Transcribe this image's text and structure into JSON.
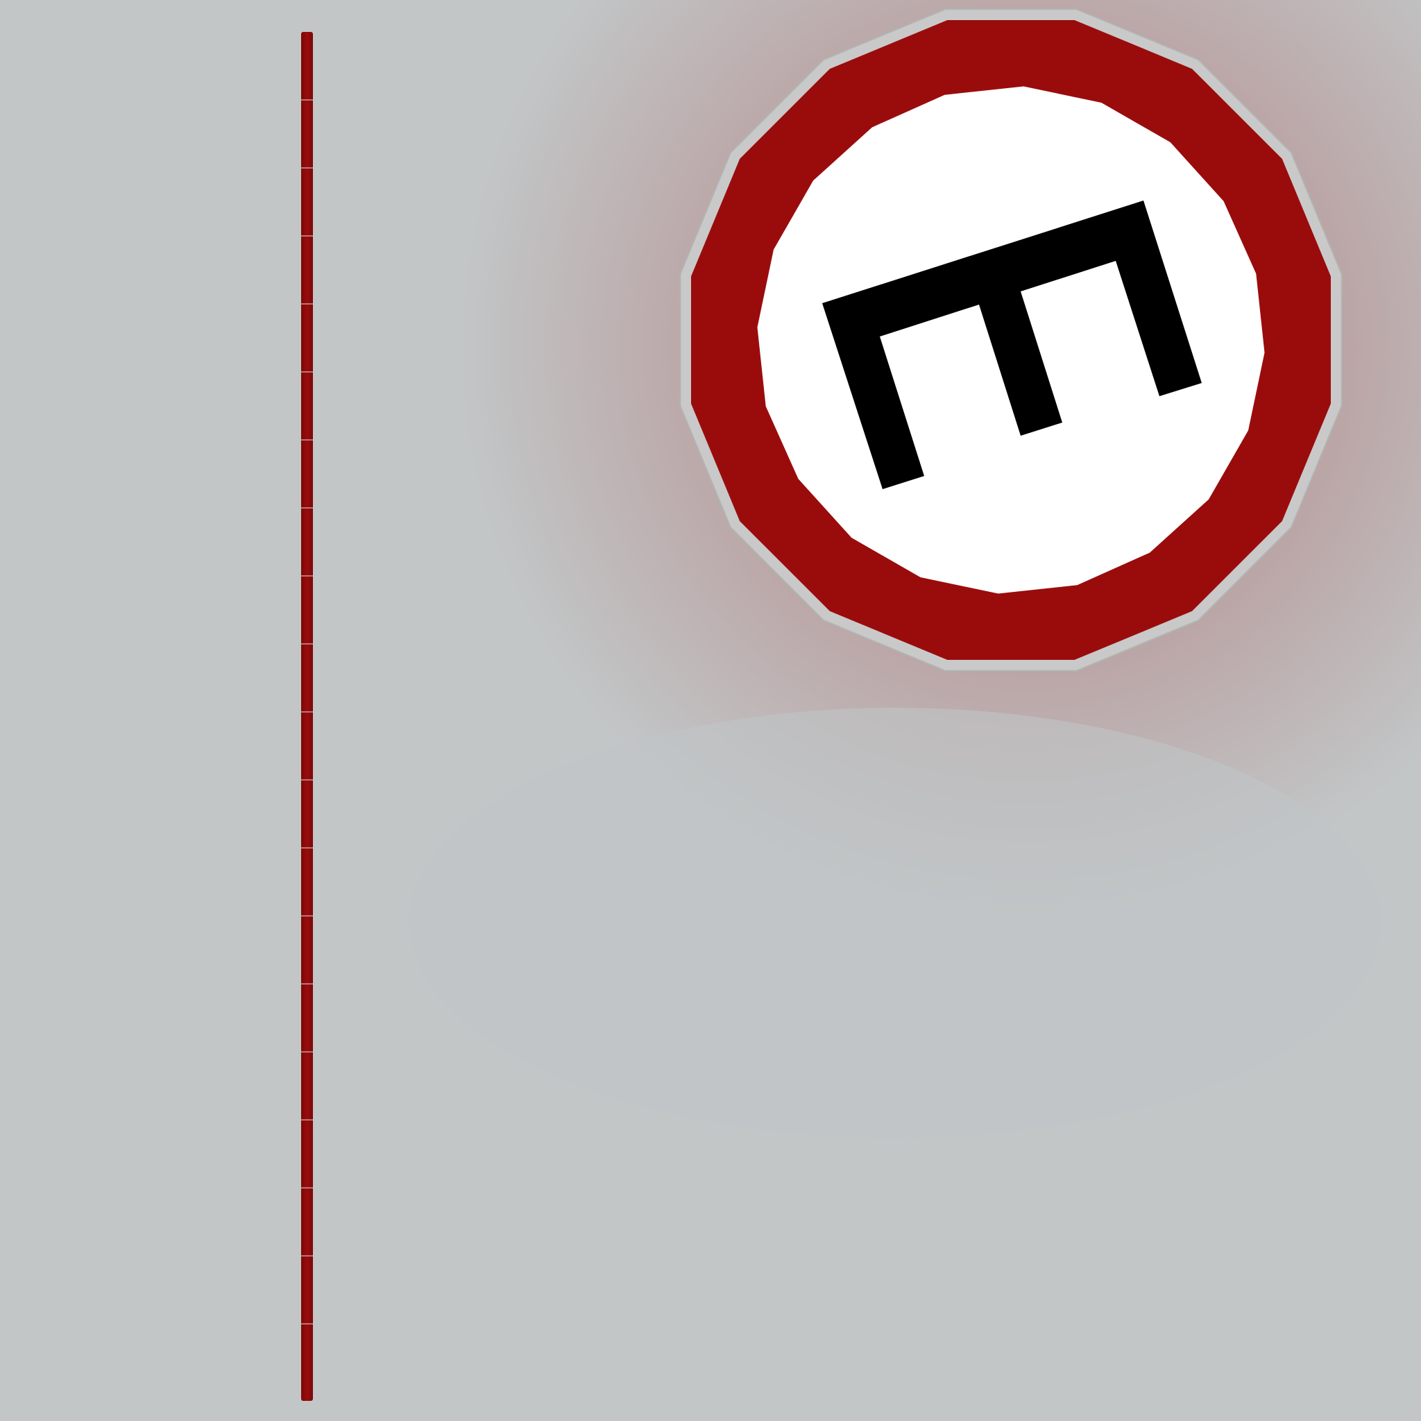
{
  "scene": {
    "background_color": "#c2c6c7",
    "glow_color": "#9a0c0c",
    "pole": {
      "color": "#9a0c0c",
      "highlight_color": "#d9d9d9"
    },
    "sign": {
      "shape": "hexadecagon",
      "border_color": "#9a0c0c",
      "rim_color": "#c9c9c9",
      "inner_color": "#ffffff",
      "symbol": "sideways-e-glyph-icon",
      "symbol_color": "#000000"
    }
  }
}
